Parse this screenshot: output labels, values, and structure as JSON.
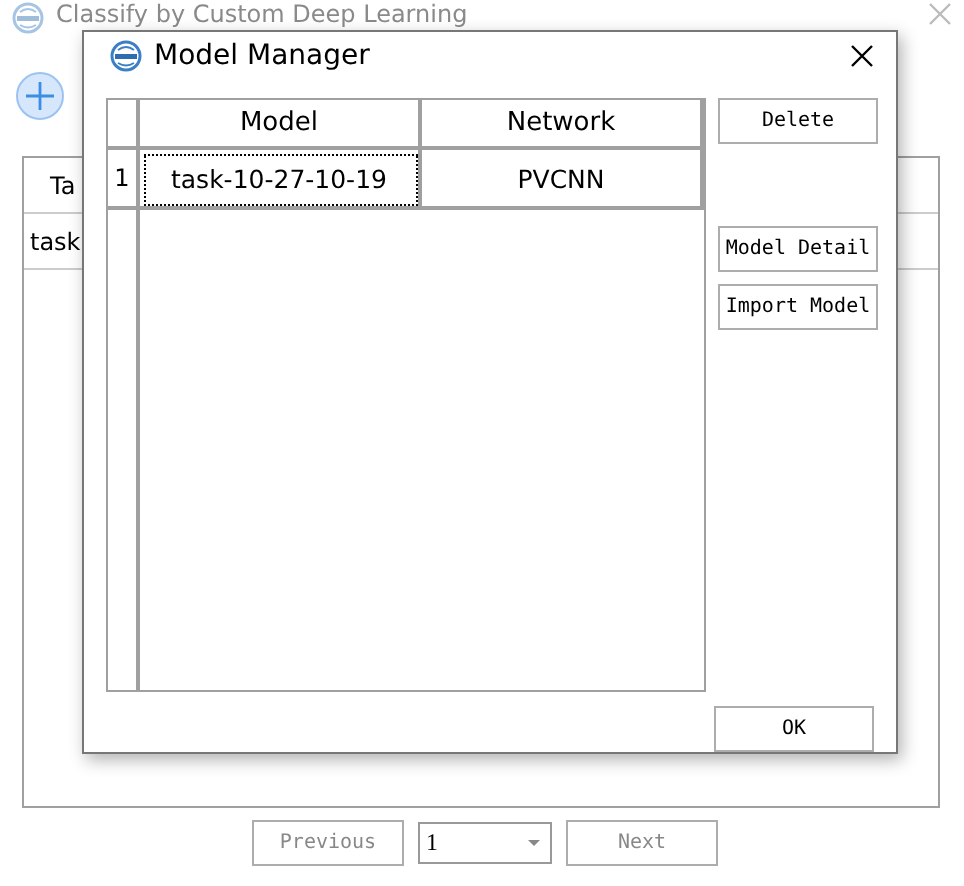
{
  "window": {
    "title": "Classify by Custom Deep Learning"
  },
  "task_table": {
    "columns": [
      "Ta"
    ],
    "rows": [
      "task"
    ]
  },
  "pager": {
    "previous": "Previous",
    "page": "1",
    "next": "Next"
  },
  "dialog": {
    "title": "Model Manager",
    "table": {
      "columns": [
        "Model",
        "Network"
      ],
      "rows": [
        {
          "index": "1",
          "model": "task-10-27-10-19",
          "network": "PVCNN",
          "focused": true
        }
      ]
    },
    "side_buttons": [
      {
        "label": "Delete",
        "kind": "top"
      },
      {
        "label": "Model Detail",
        "kind": "group"
      },
      {
        "label": "Import Model",
        "kind": "group"
      }
    ],
    "ok": "OK"
  }
}
